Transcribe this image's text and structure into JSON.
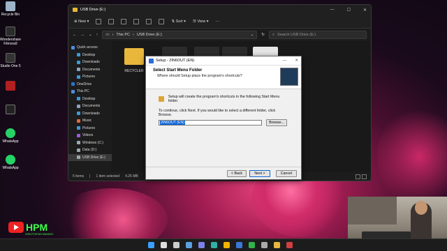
{
  "desktop": {
    "icons": [
      {
        "label": "Recycle Bin",
        "color": "#9fb4c9"
      },
      {
        "label": "Wondershare Filmora9",
        "color": "#2b2b2b"
      },
      {
        "label": "Studio One 5",
        "color": "#333333"
      },
      {
        "label": "",
        "color": "#b02020"
      },
      {
        "label": "",
        "color": "#222222"
      },
      {
        "label": "WhatsApp",
        "color": "#25d366"
      },
      {
        "label": "WhatsApp",
        "color": "#25d366"
      }
    ]
  },
  "explorer": {
    "title": "USB Drive (E:)",
    "toolbar": {
      "new_label": "New",
      "sort_label": "Sort",
      "view_label": "View"
    },
    "address": {
      "path_1": "This PC",
      "path_2": "USB Drive (E:)",
      "search_placeholder": "Search USB Drive (E:)"
    },
    "nav": [
      {
        "label": "Quick access",
        "indent": false,
        "color": "#4d8ee0"
      },
      {
        "label": "Desktop",
        "indent": true,
        "color": "#3c9bd6"
      },
      {
        "label": "Downloads",
        "indent": true,
        "color": "#3c9bd6"
      },
      {
        "label": "Documents",
        "indent": true,
        "color": "#8aa4c2"
      },
      {
        "label": "Pictures",
        "indent": true,
        "color": "#3c9bd6"
      },
      {
        "label": "OneDrive",
        "indent": false,
        "color": "#2a73d1"
      },
      {
        "label": "This PC",
        "indent": false,
        "color": "#4d8ee0"
      },
      {
        "label": "Desktop",
        "indent": true,
        "color": "#3c9bd6"
      },
      {
        "label": "Documents",
        "indent": true,
        "color": "#8aa4c2"
      },
      {
        "label": "Downloads",
        "indent": true,
        "color": "#3c9bd6"
      },
      {
        "label": "Music",
        "indent": true,
        "color": "#e06a3c"
      },
      {
        "label": "Pictures",
        "indent": true,
        "color": "#3c9bd6"
      },
      {
        "label": "Videos",
        "indent": true,
        "color": "#9a5bd6"
      },
      {
        "label": "Windows (C:)",
        "indent": true,
        "color": "#9aa"
      },
      {
        "label": "Data (D:)",
        "indent": true,
        "color": "#9aa"
      },
      {
        "label": "USB Drive (E:)",
        "indent": true,
        "color": "#9aa",
        "selected": true
      }
    ],
    "folder_label": "RECYCLER",
    "status": {
      "items": "5 items",
      "selected": "1 item selected",
      "size": "4.25 MB"
    }
  },
  "setup": {
    "title": "Setup - 2IN6OUT (EN)",
    "heading": "Select Start Menu Folder",
    "subheading": "Where should Setup place the program's shortcuts?",
    "info": "Setup will create the program's shortcuts in the following Start Menu folder.",
    "instruction": "To continue, click Next. If you would like to select a different folder, click Browse.",
    "folder_value": "2IN6OUT (EN)",
    "browse_label": "Browse...",
    "back_label": "< Back",
    "next_label": "Next >",
    "cancel_label": "Cancel"
  },
  "brand": {
    "logo_text": "HPM",
    "sub_text": "HOBI PONTAN MANADO"
  },
  "taskbar": {
    "icons": [
      {
        "name": "windows-start-icon",
        "color": "#3aa0ff"
      },
      {
        "name": "search-icon",
        "color": "#dddddd"
      },
      {
        "name": "task-view-icon",
        "color": "#cccccc"
      },
      {
        "name": "widgets-icon",
        "color": "#5aa0e0"
      },
      {
        "name": "chat-icon",
        "color": "#7b83eb"
      },
      {
        "name": "edge-icon",
        "color": "#2fb0a8"
      },
      {
        "name": "chrome-icon",
        "color": "#f2b300"
      },
      {
        "name": "store-icon",
        "color": "#3a78d8"
      },
      {
        "name": "xbox-icon",
        "color": "#2fb34a"
      },
      {
        "name": "settings-icon",
        "color": "#aaaaaa"
      },
      {
        "name": "file-explorer-icon",
        "color": "#e8b73c"
      },
      {
        "name": "app-icon",
        "color": "#d04040"
      }
    ]
  }
}
